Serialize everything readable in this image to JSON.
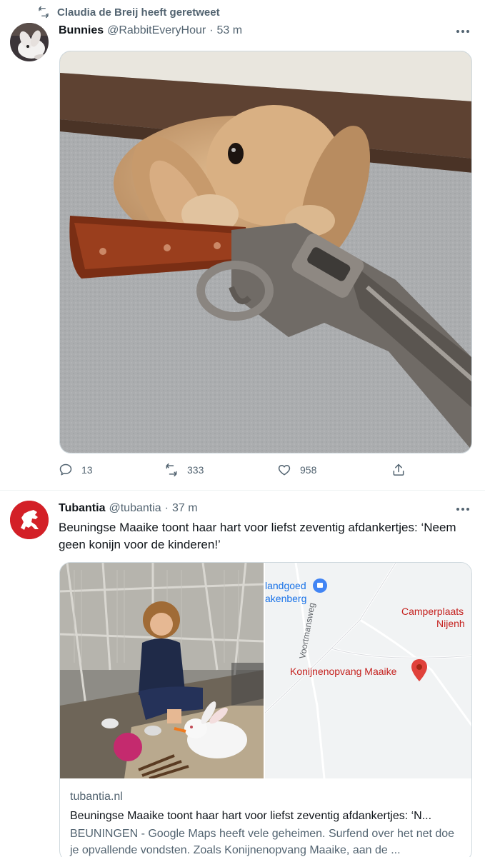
{
  "tweet1": {
    "retweet_label": "Claudia de Breij heeft geretweet",
    "name": "Bunnies",
    "handle": "@RabbitEveryHour",
    "dot": "·",
    "time": "53 m",
    "replies": "13",
    "retweets": "333",
    "likes": "958"
  },
  "tweet2": {
    "name": "Tubantia",
    "handle": "@tubantia",
    "dot": "·",
    "time": "37 m",
    "text": "Beuningse Maaike toont haar hart voor liefst zeventig afdankertjes: ‘Neem geen konijn voor de kinderen!’",
    "card": {
      "domain": "tubantia.nl",
      "title": "Beuningse Maaike toont haar hart voor liefst zeventig afdankertjes: ‘N...",
      "description": "BEUNINGEN - Google Maps heeft vele geheimen. Surfend over het net doe je opvallende vondsten. Zoals Konijnenopvang Maaike, aan de ...",
      "map_labels": {
        "estate": "landgoed",
        "estate2": "akenberg",
        "road": "Voortmansweg",
        "camp": "Camperplaats",
        "camp2": "Nijenh",
        "pin": "Konijnenopvang Maaike"
      }
    }
  },
  "colors": {
    "text": "#0f1419",
    "secondary": "#536471",
    "border": "#cfd9de",
    "tubantia_red": "#d32027",
    "map_pin": "#e0413a"
  },
  "icons": [
    "retweet-icon",
    "more-icon",
    "reply-icon",
    "like-icon",
    "share-icon",
    "map-pin-icon"
  ]
}
